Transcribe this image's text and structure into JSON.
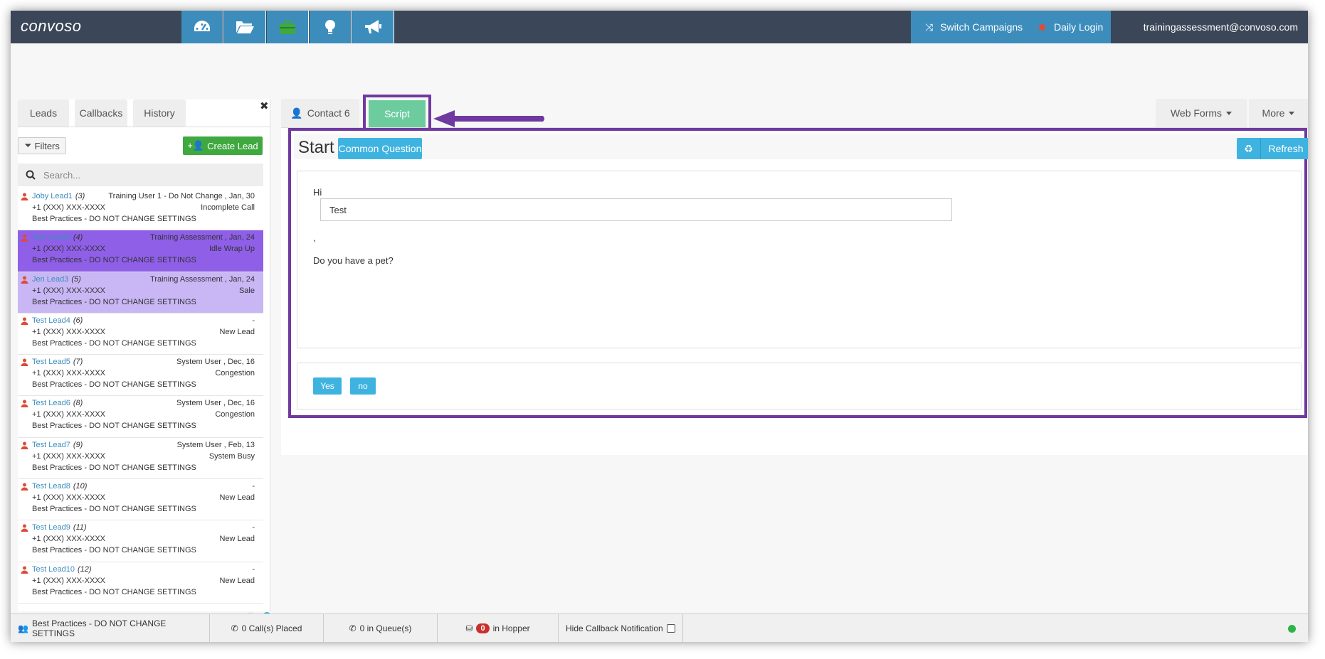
{
  "header": {
    "logo": "convoso",
    "switch_campaigns": "Switch Campaigns",
    "daily_login": "Daily Login",
    "user_email": "trainingassessment@convoso.com"
  },
  "left": {
    "tabs": [
      "Leads",
      "Callbacks",
      "History"
    ],
    "filters_label": "Filters",
    "create_lead_label": "Create Lead",
    "search_placeholder": "Search...",
    "leads": [
      {
        "name": "Joby Lead1",
        "num": "(3)",
        "meta": "Training User 1 - Do Not Change , Jan, 30",
        "phone": "+1 (XXX) XXX-XXXX",
        "status": "Incomplete Call",
        "campaign": "Best Practices - DO NOT CHANGE SETTINGS"
      },
      {
        "name": "Test Lead2",
        "num": "(4)",
        "meta": "Training Assessment , Jan, 24",
        "phone": "+1 (XXX) XXX-XXXX",
        "status": "Idle Wrap Up",
        "campaign": "Best Practices - DO NOT CHANGE SETTINGS"
      },
      {
        "name": "Jen Lead3",
        "num": "(5)",
        "meta": "Training Assessment , Jan, 24",
        "phone": "+1 (XXX) XXX-XXXX",
        "status": "Sale",
        "campaign": "Best Practices - DO NOT CHANGE SETTINGS"
      },
      {
        "name": "Test Lead4",
        "num": "(6)",
        "meta": "-",
        "phone": "+1 (XXX) XXX-XXXX",
        "status": "New Lead",
        "campaign": "Best Practices - DO NOT CHANGE SETTINGS"
      },
      {
        "name": "Test Lead5",
        "num": "(7)",
        "meta": "System User , Dec, 16",
        "phone": "+1 (XXX) XXX-XXXX",
        "status": "Congestion",
        "campaign": "Best Practices - DO NOT CHANGE SETTINGS"
      },
      {
        "name": "Test Lead6",
        "num": "(8)",
        "meta": "System User , Dec, 16",
        "phone": "+1 (XXX) XXX-XXXX",
        "status": "Congestion",
        "campaign": "Best Practices - DO NOT CHANGE SETTINGS"
      },
      {
        "name": "Test Lead7",
        "num": "(9)",
        "meta": "System User , Feb, 13",
        "phone": "+1 (XXX) XXX-XXXX",
        "status": "System Busy",
        "campaign": "Best Practices - DO NOT CHANGE SETTINGS"
      },
      {
        "name": "Test Lead8",
        "num": "(10)",
        "meta": "-",
        "phone": "+1 (XXX) XXX-XXXX",
        "status": "New Lead",
        "campaign": "Best Practices - DO NOT CHANGE SETTINGS"
      },
      {
        "name": "Test Lead9",
        "num": "(11)",
        "meta": "-",
        "phone": "+1 (XXX) XXX-XXXX",
        "status": "New Lead",
        "campaign": "Best Practices - DO NOT CHANGE SETTINGS"
      },
      {
        "name": "Test Lead10",
        "num": "(12)",
        "meta": "-",
        "phone": "+1 (XXX) XXX-XXXX",
        "status": "New Lead",
        "campaign": "Best Practices - DO NOT CHANGE SETTINGS"
      }
    ]
  },
  "main": {
    "tab_contact": "Contact 6",
    "tab_script": "Script",
    "web_forms": "Web Forms",
    "more": "More",
    "script": {
      "title": "Start",
      "common_question": "Common Question",
      "refresh": "Refresh",
      "greeting": "Hi",
      "name_value": "Test",
      "comma": ",",
      "question": "Do you have a pet?",
      "answer_yes": "Yes",
      "answer_no": "no"
    }
  },
  "footer": {
    "campaign": "Best Practices - DO NOT CHANGE SETTINGS",
    "calls_placed": "0 Call(s) Placed",
    "in_queue": "0 in Queue(s)",
    "hopper_count": "0",
    "hopper_label": "in Hopper",
    "hide_callback": "Hide Callback Notification"
  },
  "colors": {
    "topbar": "#3b4758",
    "accent": "#3c8dbc",
    "highlight": "#6f3aa0",
    "selected_lead": "#8f5fe8",
    "selected_lead_light": "#c8b6f5"
  }
}
